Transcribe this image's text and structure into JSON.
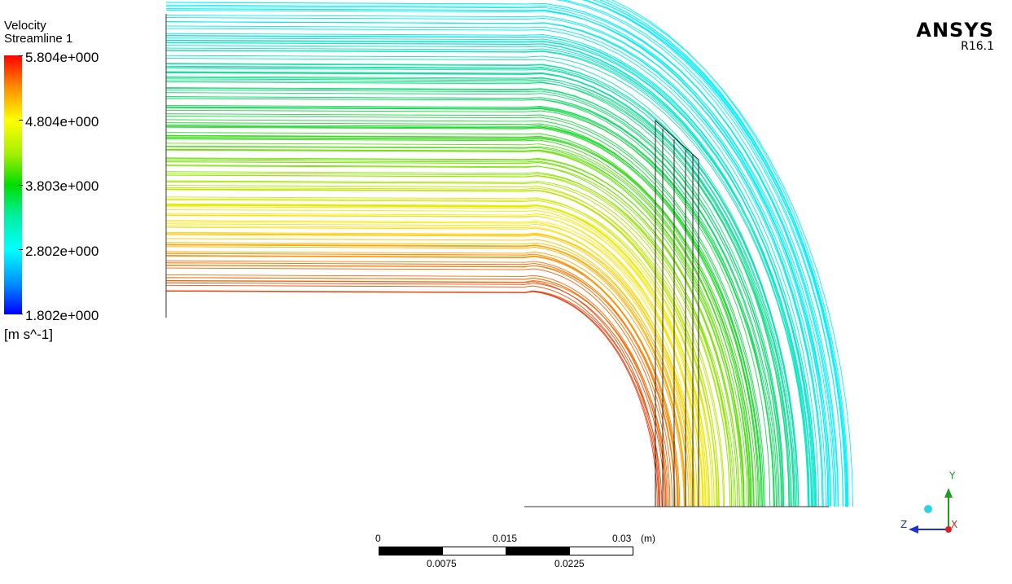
{
  "legend": {
    "title_line1": "Velocity",
    "title_line2": "Streamline 1",
    "values": [
      "5.804e+000",
      "4.804e+000",
      "3.803e+000",
      "2.802e+000",
      "1.802e+000"
    ],
    "unit": "[m s^-1]",
    "colors": [
      "#ff0000",
      "#ffff00",
      "#00dd00",
      "#00ffff",
      "#0000ff"
    ]
  },
  "brand": {
    "name": "ANSYS",
    "version": "R16.1"
  },
  "scale_bar": {
    "top_labels": [
      "0",
      "0.015",
      "0.03"
    ],
    "unit": "(m)",
    "bottom_labels": [
      "0.0075",
      "0.0225"
    ]
  },
  "axis_triad": {
    "x": "X",
    "y": "Y",
    "z": "Z",
    "y_color": "#1e9e1e",
    "z_color": "#1c2fd8",
    "x_color": "#e01e1e"
  }
}
